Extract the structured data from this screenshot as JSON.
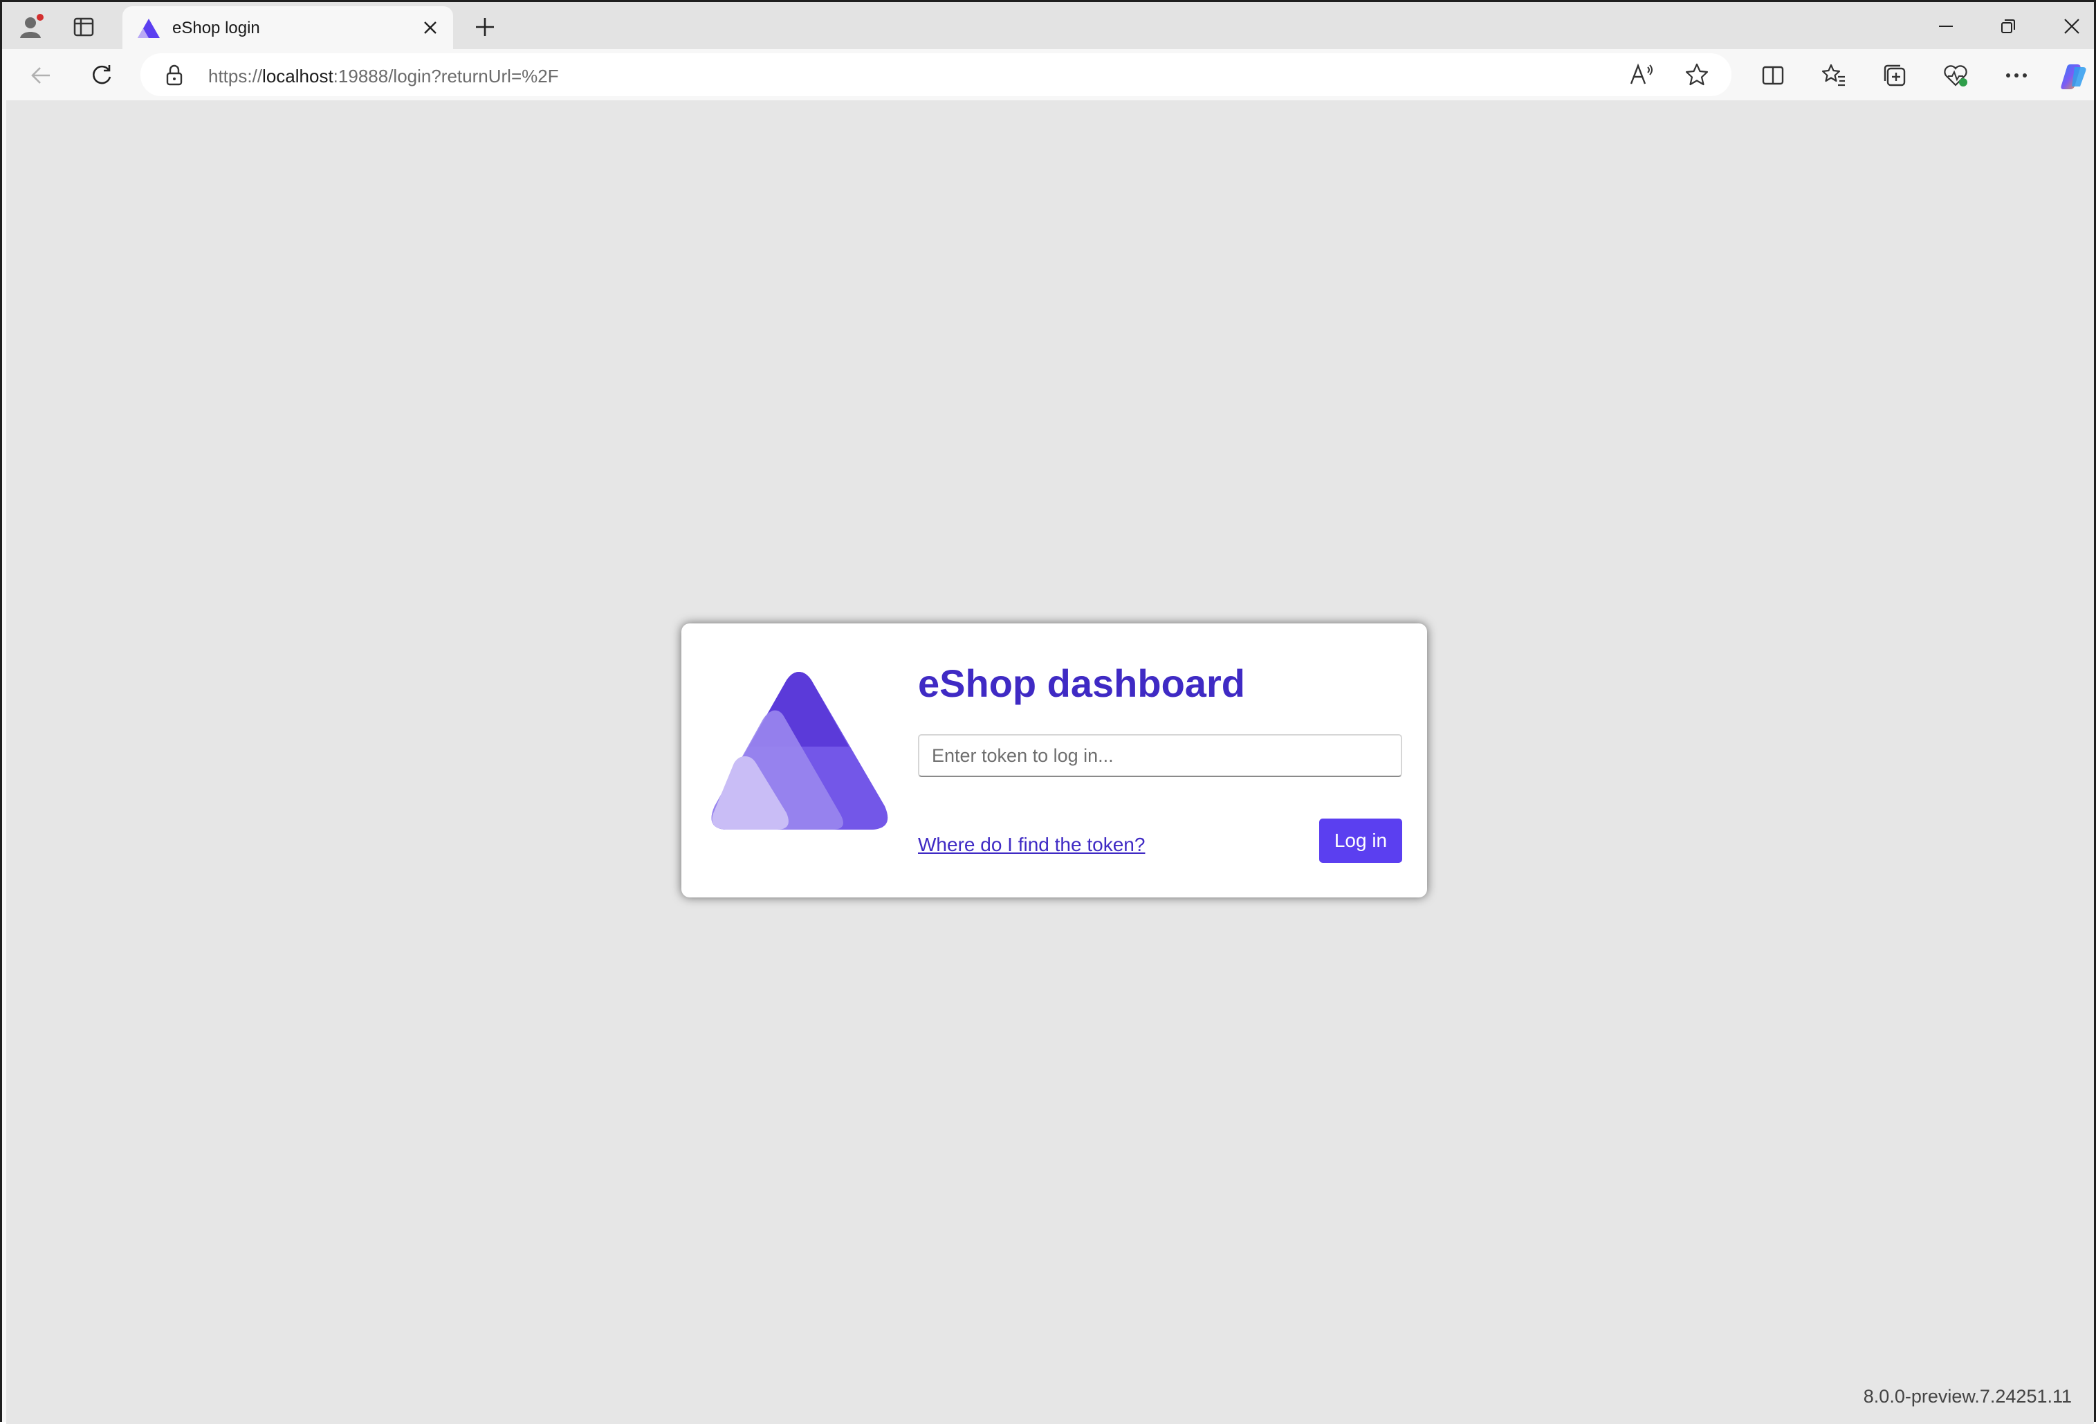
{
  "browser": {
    "tab": {
      "title": "eShop login",
      "favicon": "triangle-logo-icon",
      "close_icon": "close-icon"
    },
    "new_tab_icon": "plus-icon",
    "window_controls": [
      "minimize-icon",
      "restore-icon",
      "close-icon"
    ],
    "address": {
      "scheme": "https://",
      "host": "localhost",
      "rest": ":19888/login?returnUrl=%2F"
    },
    "toolbar_icons": [
      "read-aloud-icon",
      "favorite-star-icon",
      "split-screen-icon",
      "favorites-icon",
      "collections-icon",
      "browser-essentials-icon",
      "more-icon",
      "copilot-icon"
    ]
  },
  "login": {
    "title": "eShop dashboard",
    "token_placeholder": "Enter token to log in...",
    "token_value": "",
    "help_link": "Where do I find the token?",
    "login_button": "Log in"
  },
  "footer": {
    "version": "8.0.0-preview.7.24251.11"
  },
  "colors": {
    "accent": "#5b3ff0",
    "title": "#3f2ac4",
    "page_background": "#e6e6e6"
  }
}
